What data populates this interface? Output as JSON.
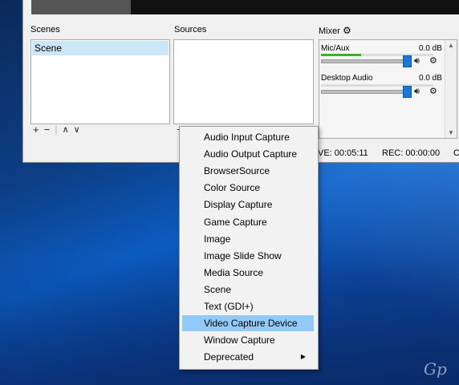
{
  "panels": {
    "scenes_title": "Scenes",
    "sources_title": "Sources",
    "mixer_title": "Mixer"
  },
  "scenes": [
    "Scene"
  ],
  "scene_toolbar": {
    "add": "+",
    "remove": "−",
    "up": "∧",
    "down": "∨"
  },
  "mixer": {
    "channels": [
      {
        "name": "Mic/Aux",
        "db": "0.0 dB",
        "level": 0.36,
        "volume": 1.0
      },
      {
        "name": "Desktop Audio",
        "db": "0.0 dB",
        "level": 0.0,
        "volume": 1.0
      }
    ]
  },
  "status": {
    "live": "VE: 00:05:11",
    "rec": "REC: 00:00:00",
    "cpu": "C"
  },
  "context_menu": {
    "items": [
      "Audio Input Capture",
      "Audio Output Capture",
      "BrowserSource",
      "Color Source",
      "Display Capture",
      "Game Capture",
      "Image",
      "Image Slide Show",
      "Media Source",
      "Scene",
      "Text (GDI+)",
      "Video Capture Device",
      "Window Capture",
      "Deprecated"
    ],
    "highlighted": "Video Capture Device",
    "submenu_item": "Deprecated"
  },
  "watermark": "Gp",
  "colors": {
    "highlight": "#91c9f7",
    "scene_selected": "#cde6f7",
    "slider_handle": "#1979d4",
    "meter_green": "#3fae2a"
  },
  "icons": {
    "mixer_settings": "gear-icon",
    "speaker": "speaker-icon",
    "channel_settings": "gear-icon",
    "submenu": "triangle-right-icon"
  }
}
